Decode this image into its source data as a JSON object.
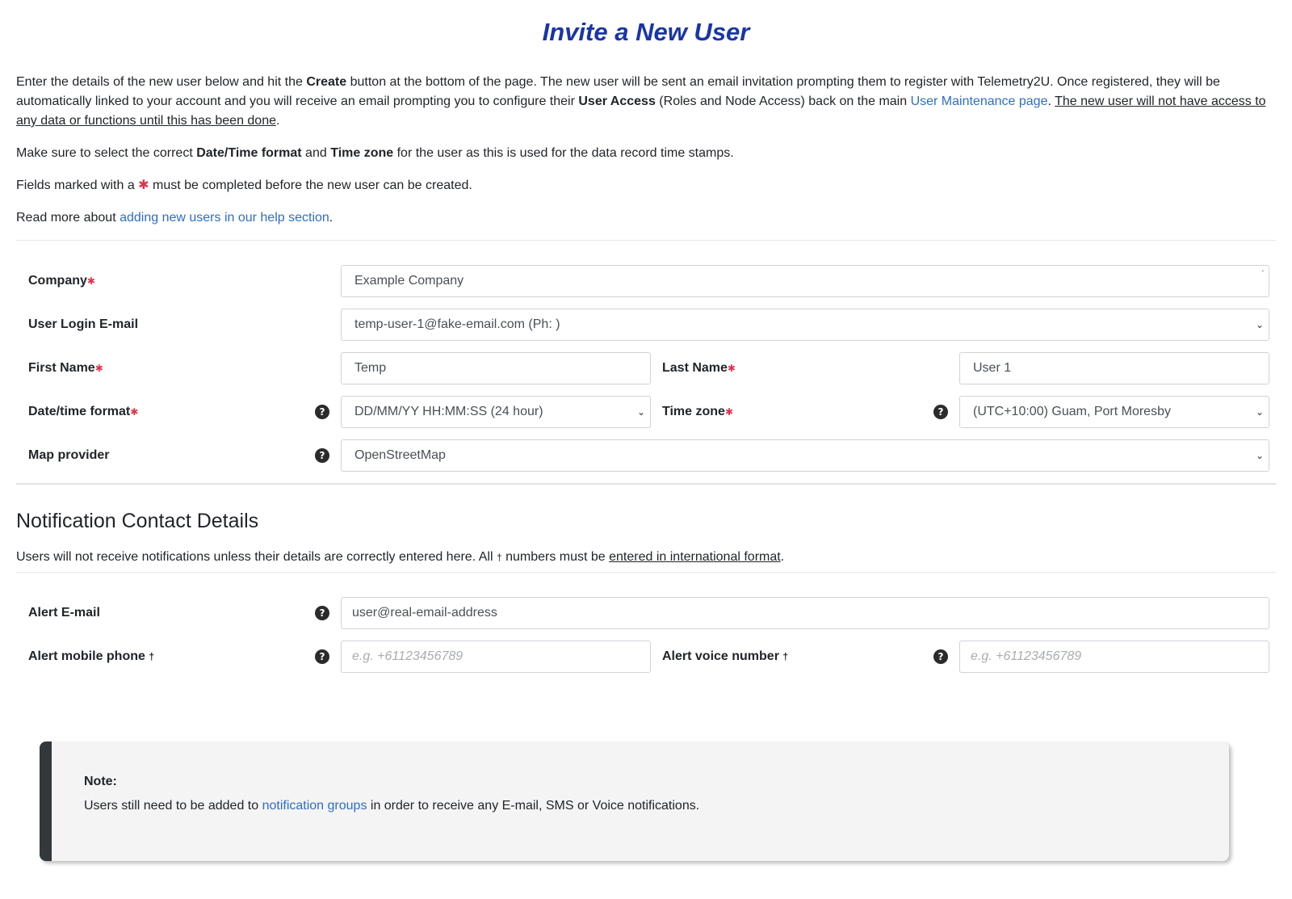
{
  "title": "Invite a New User",
  "intro": {
    "p1": {
      "a": "Enter the details of the new user below and hit the ",
      "b_create": "Create",
      "c": " button at the bottom of the page. The new user will be sent an email invitation prompting them to register with Telemetry2U. Once registered, they will be automatically linked to your account and you will receive an email prompting you to configure their ",
      "d_access": "User Access",
      "e": " (Roles and Node Access) back on the main ",
      "f_link": "User Maintenance page",
      "g": ". ",
      "h_underline": "The new user will not have access to any data or functions until this has been done",
      "i": "."
    },
    "p2": {
      "a": "Make sure to select the correct ",
      "b_datetime": "Date/Time format",
      "c": " and ",
      "d_tz": "Time zone",
      "e": " for the user as this is used for the data record time stamps."
    },
    "p3": {
      "a": "Fields marked with a ",
      "star": "✱",
      "b": " must be completed before the new user can be created."
    },
    "p4": {
      "a": "Read more about ",
      "link": "adding new users in our help section",
      "b": "."
    }
  },
  "form": {
    "company_label": "Company",
    "company_value": "Example Company",
    "login_label": "User Login E-mail",
    "login_value": "temp-user-1@fake-email.com (Ph: )",
    "first_label": "First Name",
    "first_value": "Temp",
    "last_label": "Last Name",
    "last_value": "User 1",
    "datetime_label": "Date/time format",
    "datetime_value": "DD/MM/YY HH:MM:SS (24 hour)",
    "tz_label": "Time zone",
    "tz_value": "(UTC+10:00) Guam, Port Moresby",
    "map_label": "Map provider",
    "map_value": "OpenStreetMap",
    "required_star": "✱"
  },
  "notify": {
    "title": "Notification Contact Details",
    "sub_a": "Users will not receive notifications unless their details are correctly entered here. All ",
    "dagger": "†",
    "sub_b": " numbers must be ",
    "sub_link": "entered in international format",
    "sub_c": ".",
    "alert_email_label": "Alert E-mail",
    "alert_email_value": "user@real-email-address",
    "mobile_label": "Alert mobile phone",
    "mobile_placeholder": "e.g. +61123456789",
    "voice_label": "Alert voice number",
    "voice_placeholder": "e.g. +61123456789"
  },
  "note": {
    "title": "Note:",
    "a": "Users still need to be added to ",
    "link": "notification groups",
    "b": " in order to receive any E-mail, SMS or Voice notifications."
  },
  "icons": {
    "help": "?",
    "chevron": "⌄"
  }
}
